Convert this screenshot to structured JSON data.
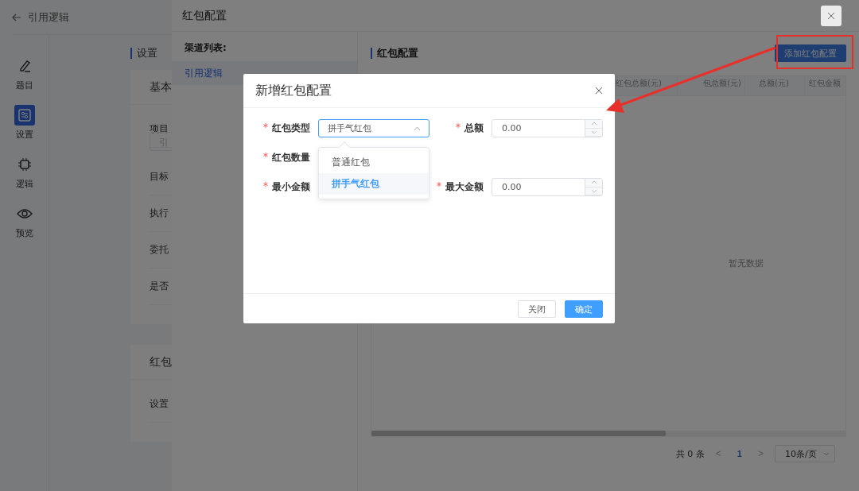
{
  "app": {
    "back_title": "引用逻辑",
    "nav": [
      {
        "label": "题目",
        "kind": "pen",
        "selected": false
      },
      {
        "label": "设置",
        "kind": "settings",
        "selected": true
      },
      {
        "label": "逻辑",
        "kind": "chip",
        "selected": false
      },
      {
        "label": "预览",
        "kind": "eye",
        "selected": false
      }
    ],
    "section_title": "设置",
    "cards": [
      {
        "title": "基本",
        "fields": [
          {
            "label": "项目",
            "placeholder": "引"
          },
          {
            "label": "目标"
          },
          {
            "label": "执行"
          },
          {
            "label": "委托"
          },
          {
            "label": "是否"
          }
        ]
      },
      {
        "title": "红包",
        "fields": [
          {
            "label": "设置"
          }
        ]
      }
    ]
  },
  "drawer": {
    "title": "红包配置",
    "channel_list_title": "渠道列表:",
    "channels": [
      {
        "name": "引用逻辑",
        "selected": true
      }
    ],
    "section_title": "红包配置",
    "add_button": "添加红包配置",
    "columns": [
      "红包总额(元)",
      "包总额(元)",
      "总额(元)",
      "红包金额"
    ],
    "empty_text": "暂无数据",
    "pagination": {
      "total": "共 0 条",
      "prev": "<",
      "pages": [
        {
          "label": "1",
          "selected": true
        }
      ],
      "next": ">",
      "page_size": "10条/页"
    }
  },
  "dialog": {
    "title": "新增红包配置",
    "fields": [
      {
        "label": "红包类型",
        "required": true,
        "kind": "select",
        "value": "拼手气红包",
        "open": true
      },
      {
        "label": "总额",
        "required": true,
        "kind": "number",
        "value": "0.00"
      },
      {
        "label": "红包数量",
        "required": true,
        "kind": "covered"
      },
      {
        "kind": "empty"
      },
      {
        "label": "最小金额",
        "required": true,
        "kind": "covered"
      },
      {
        "label": "最大金额",
        "required": true,
        "kind": "number",
        "value": "0.00"
      }
    ],
    "options": [
      {
        "label": "普通红包",
        "selected": false
      },
      {
        "label": "拼手气红包",
        "selected": true
      }
    ],
    "buttons": [
      {
        "label": "关闭",
        "kind": "default"
      },
      {
        "label": "确定",
        "kind": "primary"
      }
    ]
  }
}
